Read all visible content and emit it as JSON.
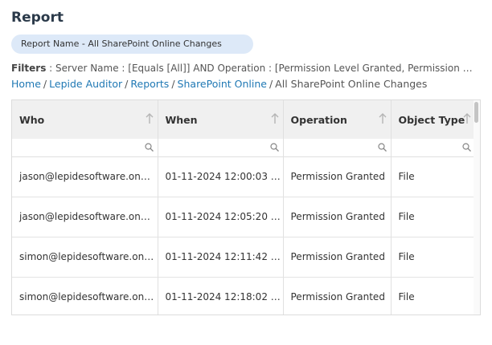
{
  "page": {
    "title": "Report",
    "report_name": "Report Name - All SharePoint Online Changes",
    "filters_label": "Filters",
    "filters_text": " : Server Name : [Equals [All]] AND Operation : [Permission Level Granted, Permission Level Modified, Permission Granted]"
  },
  "breadcrumb": {
    "items": [
      "Home",
      "Lepide Auditor",
      "Reports",
      "SharePoint Online"
    ],
    "current": "All SharePoint Online Changes",
    "separator": "/"
  },
  "grid": {
    "columns": [
      "Who",
      "When",
      "Operation",
      "Object Type"
    ],
    "rows": [
      [
        "jason@lepidesoftware.onmicrosoft.com",
        "01-11-2024 12:00:03 AM",
        "Permission Granted",
        "File"
      ],
      [
        "jason@lepidesoftware.onmicrosoft.com",
        "01-11-2024 12:05:20 AM",
        "Permission Granted",
        "File"
      ],
      [
        "simon@lepidesoftware.onmicrosoft.com",
        "01-11-2024 12:11:42 AM",
        "Permission Granted",
        "File"
      ],
      [
        "simon@lepidesoftware.onmicrosoft.com",
        "01-11-2024 12:18:02 AM",
        "Permission Granted",
        "File"
      ]
    ],
    "filter_values": [
      "",
      "",
      "",
      ""
    ]
  },
  "icons": {
    "sort": "sort-up-arrow-icon",
    "search": "search-icon"
  },
  "colors": {
    "link": "#1f78b4",
    "pill": "#dde9f8",
    "header_bg": "#f0f0f0"
  }
}
